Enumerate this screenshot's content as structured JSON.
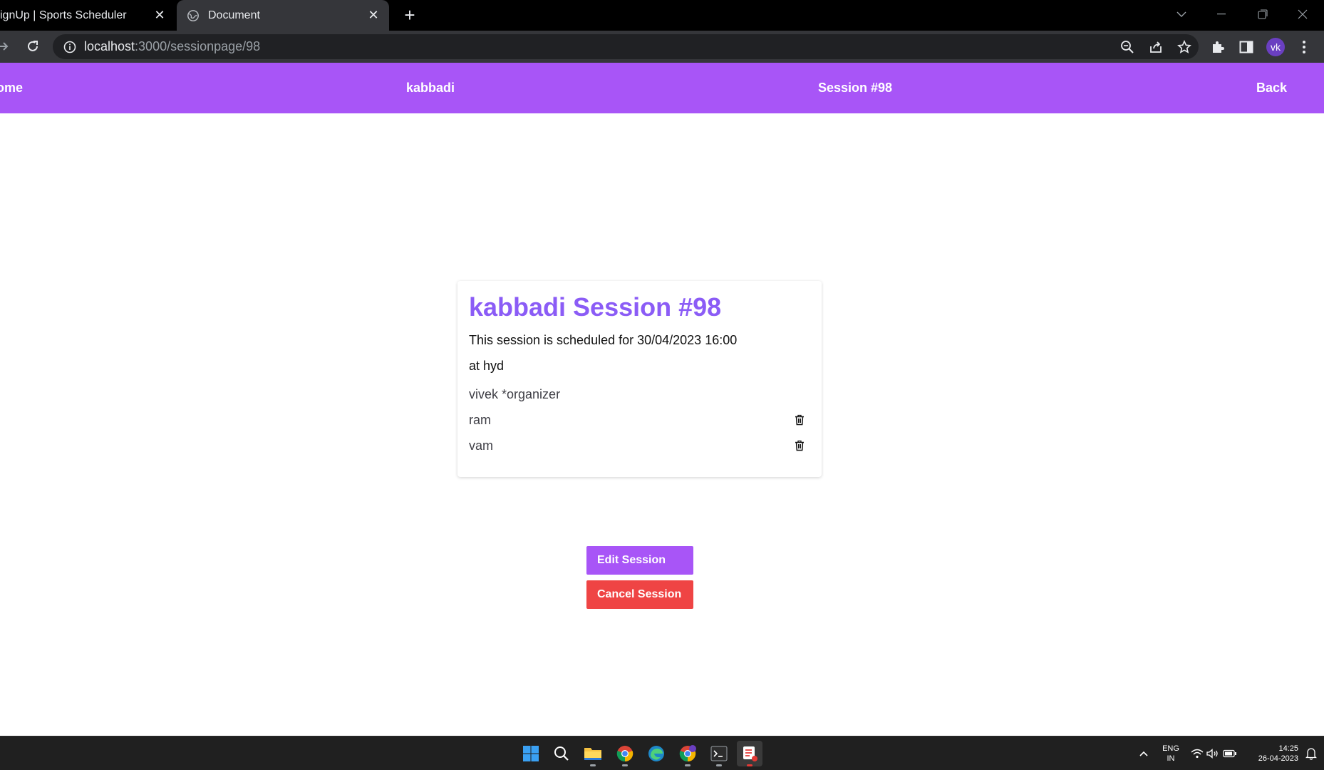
{
  "browser": {
    "tabs": [
      {
        "title": "ignUp | Sports Scheduler",
        "active": false
      },
      {
        "title": "Document",
        "active": true
      }
    ],
    "url_host": "localhost",
    "url_path": ":3000/sessionpage/98",
    "avatar_initials": "vk"
  },
  "nav": {
    "home": "lome",
    "sport": "kabbadi",
    "session": "Session #98",
    "back": "Back"
  },
  "session": {
    "title": "kabbadi Session #98",
    "schedule": "This session is scheduled for 30/04/2023 16:00",
    "venue": "at hyd",
    "players": [
      {
        "name": "vivek *organizer",
        "deletable": false
      },
      {
        "name": "ram",
        "deletable": true
      },
      {
        "name": "vam",
        "deletable": true
      }
    ]
  },
  "actions": {
    "edit": "Edit Session",
    "cancel": "Cancel Session"
  },
  "taskbar": {
    "lang_line1": "ENG",
    "lang_line2": "IN",
    "time": "14:25",
    "date": "26-04-2023"
  },
  "colors": {
    "nav_bg": "#a855f7",
    "title": "#8b5cf6",
    "edit_button": "#a855f7",
    "cancel_button": "#ef4444"
  }
}
